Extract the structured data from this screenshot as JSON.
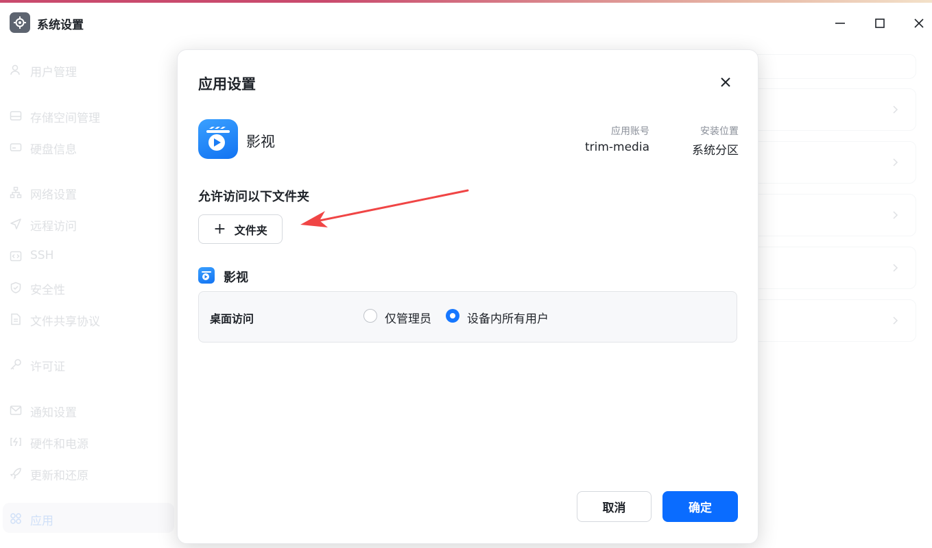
{
  "window": {
    "title": "系统设置",
    "controls": [
      "minimize-icon",
      "maximize-icon",
      "close-icon"
    ]
  },
  "sidebar": {
    "items": [
      {
        "label": "用户管理",
        "icon": "user-icon"
      },
      {
        "label": "存储空间管理",
        "icon": "storage-icon"
      },
      {
        "label": "硬盘信息",
        "icon": "disk-icon"
      },
      {
        "label": "网络设置",
        "icon": "network-icon"
      },
      {
        "label": "远程访问",
        "icon": "send-icon"
      },
      {
        "label": "SSH",
        "icon": "code-icon"
      },
      {
        "label": "安全性",
        "icon": "shield-icon"
      },
      {
        "label": "文件共享协议",
        "icon": "file-icon"
      },
      {
        "label": "许可证",
        "icon": "key-icon"
      },
      {
        "label": "通知设置",
        "icon": "mail-icon"
      },
      {
        "label": "硬件和电源",
        "icon": "power-icon"
      },
      {
        "label": "更新和还原",
        "icon": "rocket-icon"
      },
      {
        "label": "应用",
        "icon": "apps-icon",
        "active": true
      }
    ]
  },
  "dialog": {
    "title": "应用设置",
    "app_name": "影视",
    "account_label": "应用账号",
    "account_value": "trim-media",
    "location_label": "安装位置",
    "location_value": "系统分区",
    "folders_title": "允许访问以下文件夹",
    "add_folder_label": "文件夹",
    "app_section_name": "影视",
    "desktop_access_label": "桌面访问",
    "options": [
      {
        "label": "仅管理员",
        "selected": false
      },
      {
        "label": "设备内所有用户",
        "selected": true
      }
    ],
    "cancel_label": "取消",
    "confirm_label": "确定"
  },
  "colors": {
    "accent": "#0a6cff",
    "annotation_arrow": "#f04545"
  }
}
